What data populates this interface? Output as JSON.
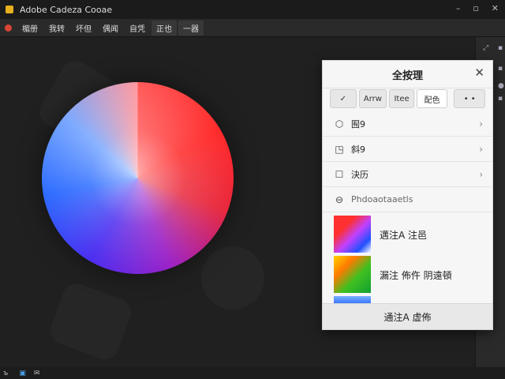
{
  "window": {
    "title": "Adobe Cadeza Cooae",
    "controls": [
      "–",
      "▫",
      "✕"
    ]
  },
  "menubar": {
    "items": [
      "楣册",
      "我转",
      "坏但",
      "偶闻",
      "自凭"
    ],
    "group_items": [
      "正也",
      "一器"
    ]
  },
  "panel": {
    "title": "全按理",
    "close": "✕",
    "tabs": [
      "✓",
      "Arrw",
      "Itee",
      "配色",
      "• •"
    ],
    "rows": [
      {
        "icon": "hexagon-icon",
        "glyph": "⬡",
        "label": "囿9",
        "chevron": "›"
      },
      {
        "icon": "square-corner-icon",
        "glyph": "◳",
        "label": "斜9",
        "chevron": "›"
      },
      {
        "icon": "square-icon",
        "glyph": "☐",
        "label": "決历",
        "chevron": "›"
      }
    ],
    "section": {
      "icon": "circle-minus-icon",
      "glyph": "⊖",
      "label": "Phdoaotaaetls"
    },
    "presets": [
      {
        "label": "邁注A  注邑"
      },
      {
        "label": "漏注 佈仵  阴遠頓"
      }
    ],
    "footer": "通注A  虚佈"
  },
  "statusbar": {
    "items": [
      "ъ",
      "▣",
      "✉"
    ]
  },
  "colors": {
    "accent": "#e8b020",
    "panel_bg": "#f6f6f6",
    "canvas_bg": "#202020"
  }
}
